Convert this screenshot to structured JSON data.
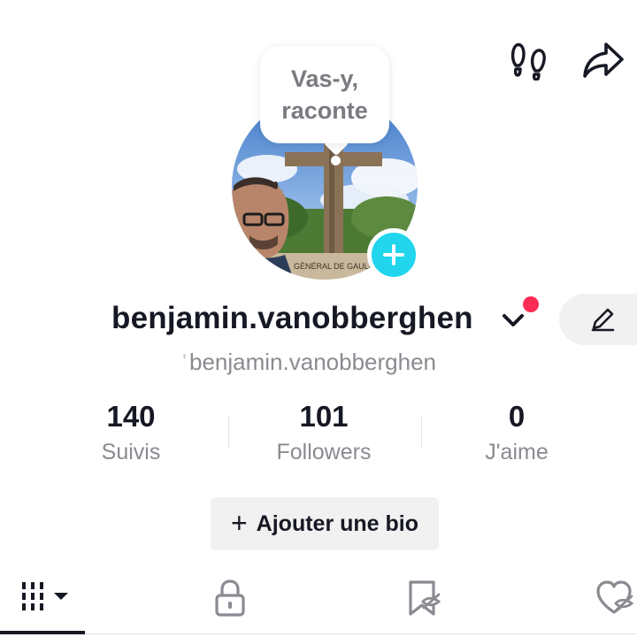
{
  "header": {
    "icons": [
      "footprints-icon",
      "share-icon"
    ]
  },
  "avatar": {
    "bubble_line1": "Vas-y,",
    "bubble_line2": "raconte",
    "add_icon": "plus-icon",
    "photo_caption": "GÉNÉRAL DE GAULLE"
  },
  "profile": {
    "username": "benjamin.vanobberghen",
    "handle_prefix": "'",
    "handle": "benjamin.vanobberghen",
    "dropdown_icon": "chevron-down-icon",
    "edit_icon": "pencil-icon"
  },
  "stats": [
    {
      "value": "140",
      "label": "Suivis"
    },
    {
      "value": "101",
      "label": "Followers"
    },
    {
      "value": "0",
      "label": "J'aime"
    }
  ],
  "bio": {
    "plus": "+",
    "label": "Ajouter une bio"
  },
  "tabs": [
    {
      "icon": "grid-icon",
      "active": true
    },
    {
      "icon": "lock-icon"
    },
    {
      "icon": "bookmark-hidden-icon"
    },
    {
      "icon": "heart-hidden-icon"
    }
  ],
  "colors": {
    "accent_add": "#20d5ec",
    "notification": "#fe2c55",
    "text_primary": "#161823",
    "text_secondary": "#8a8b91",
    "button_bg": "#f1f1f2"
  }
}
